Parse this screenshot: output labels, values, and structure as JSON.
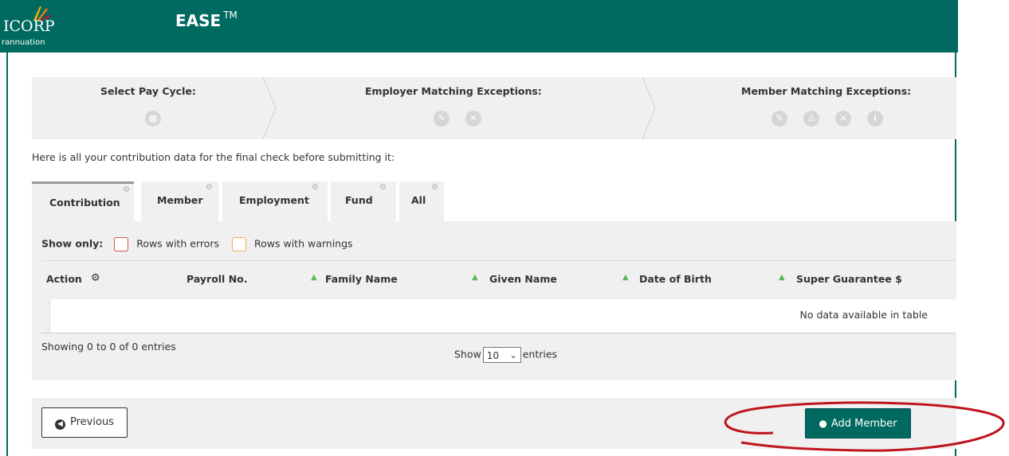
{
  "header": {
    "logo_text": "ICORP",
    "logo_sub": "rannuation",
    "app_title": "EASE",
    "trademark": "TM"
  },
  "steps": [
    {
      "title": "Select Pay Cycle:",
      "icons": [
        "calendar-icon"
      ]
    },
    {
      "title": "Employer Matching Exceptions:",
      "icons": [
        "pencil-icon",
        "x-icon"
      ]
    },
    {
      "title": "Member Matching Exceptions:",
      "icons": [
        "pencil-icon",
        "warning-icon",
        "x-icon",
        "info-icon"
      ]
    }
  ],
  "intro_text": "Here is all your contribution data for the final check before submitting it:",
  "tabs": [
    {
      "label": "Contribution",
      "active": true
    },
    {
      "label": "Member",
      "active": false
    },
    {
      "label": "Employment",
      "active": false
    },
    {
      "label": "Fund",
      "active": false
    },
    {
      "label": "All",
      "active": false
    }
  ],
  "filter": {
    "label": "Show only:",
    "errors_label": "Rows with errors",
    "warnings_label": "Rows with warnings",
    "errors_color": "#d9534f",
    "warnings_color": "#f0ad4e"
  },
  "table": {
    "columns": [
      "Action",
      "Payroll No.",
      "Family Name",
      "Given Name",
      "Date of Birth",
      "Super Guarantee $"
    ],
    "empty_text": "No data available in table",
    "info_text": "Showing 0 to 0 of 0 entries",
    "length_prefix": "Show",
    "length_value": "10",
    "length_suffix": "entries"
  },
  "buttons": {
    "previous_label": "Previous",
    "add_member_label": "Add Member"
  },
  "colors": {
    "brand": "#006a61",
    "annotation": "#c0141c",
    "sort_arrow": "#5cb85c"
  }
}
